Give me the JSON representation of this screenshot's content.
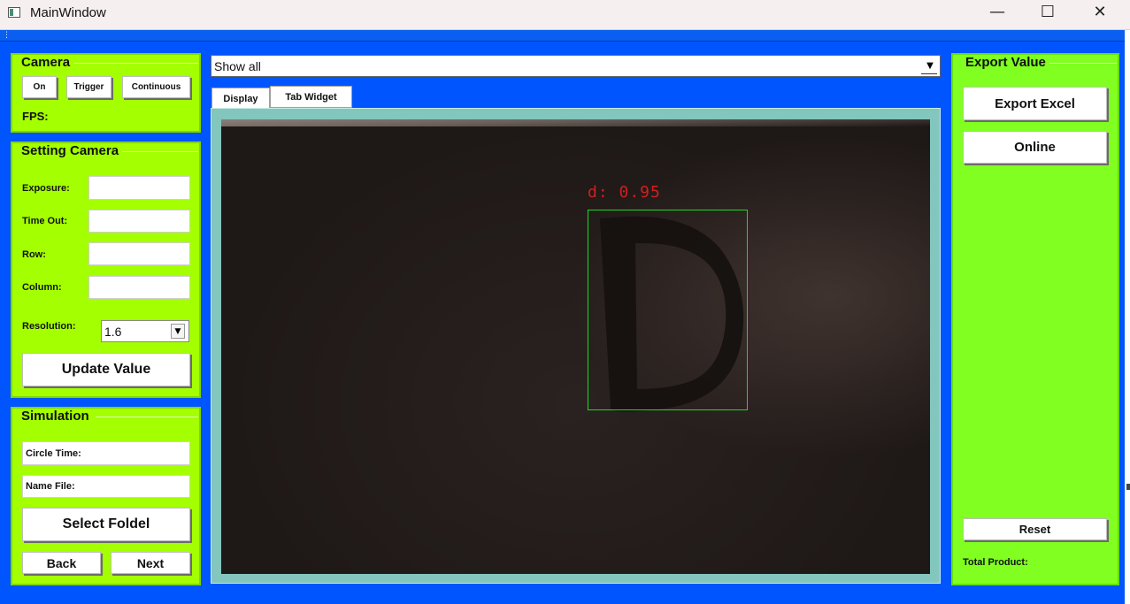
{
  "window": {
    "title": "MainWindow",
    "minimize": "—",
    "maximize": "☐",
    "close": "✕"
  },
  "camera_panel": {
    "title": "Camera",
    "on_label": "On",
    "trigger_label": "Trigger",
    "continuous_label": "Continuous",
    "fps_label": "FPS:"
  },
  "setting_panel": {
    "title": "Setting Camera",
    "exposure_label": "Exposure:",
    "timeout_label": "Time Out:",
    "row_label": "Row:",
    "column_label": "Column:",
    "exposure_value": "",
    "timeout_value": "",
    "row_value": "",
    "column_value": "",
    "resolution_label": "Resolution:",
    "resolution_value": "1.6",
    "update_label": "Update Value"
  },
  "simulation_panel": {
    "title": "Simulation",
    "circle_time_label": "Circle Time:",
    "name_file_label": "Name File:",
    "select_folder_label": "Select Foldel",
    "back_label": "Back",
    "next_label": "Next"
  },
  "view_selector": {
    "value": "Show all"
  },
  "tabs": [
    {
      "label": "Display",
      "active": true
    },
    {
      "label": "Tab Widget",
      "active": false
    }
  ],
  "camera_view": {
    "detection_label": "d: 0.95",
    "detection_color": "#1fd81f",
    "label_color": "#d02020"
  },
  "export_panel": {
    "title": "Export Value",
    "export_excel_label": "Export Excel",
    "online_label": "Online",
    "reset_label": "Reset",
    "total_product_label": "Total Product:"
  },
  "colors": {
    "window_bg": "#0055ff",
    "panel_bg": "#a4ff00",
    "export_panel_bg": "#80ff20",
    "viewer_frame": "#82c6be"
  }
}
